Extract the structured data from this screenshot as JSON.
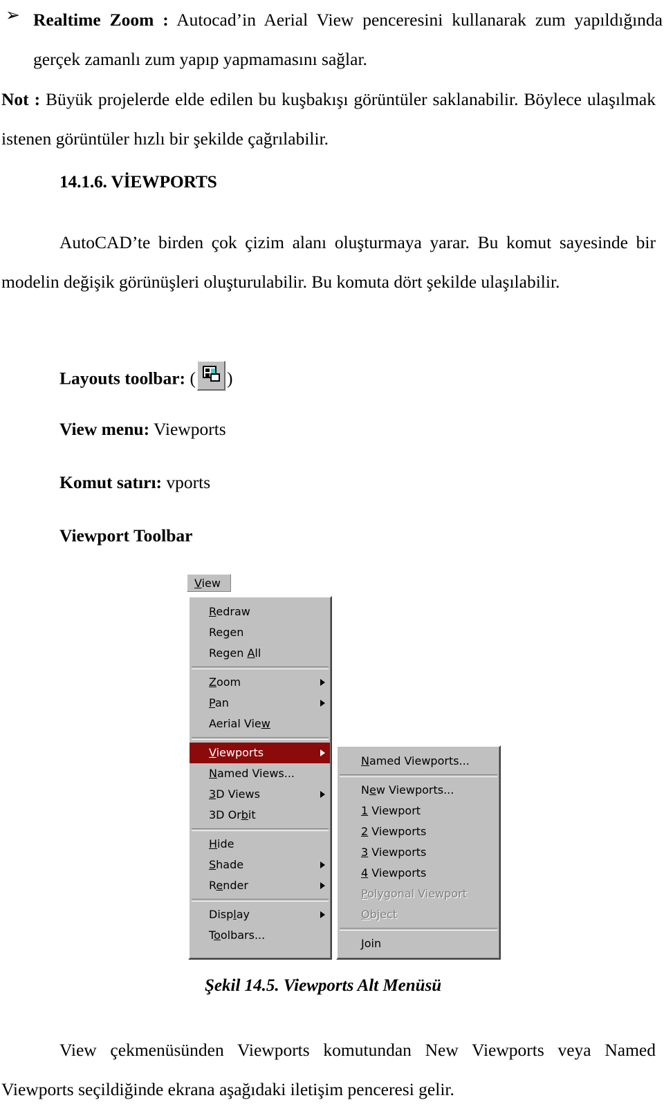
{
  "document": {
    "bullet_glyph": "➢",
    "intro_bullet": {
      "term": "Realtime Zoom :",
      "text": " Autocad’in Aerial View penceresini kullanarak zum yapıldığında gerçek zamanlı zum yapıp yapmamasını sağlar."
    },
    "note": {
      "term": "Not :",
      "text": " Büyük projelerde elde edilen bu kuşbakışı görüntüler saklanabilir. Böylece ulaşılmak istenen görüntüler hızlı bir şekilde çağrılabilir."
    },
    "section_heading": "14.1.6. VİEWPORTS",
    "body_paragraph": "AutoCAD’te birden çok çizim alanı oluşturmaya yarar. Bu komut sayesinde bir modelin değişik görünüşleri oluşturulabilir. Bu komuta dört şekilde ulaşılabilir.",
    "access_methods": {
      "toolbar_label": "Layouts toolbar:",
      "toolbar_paren_open": "(",
      "toolbar_paren_close": ")",
      "toolbar_icon_name": "viewports-toolbar-icon",
      "menu_label": "View menu:",
      "menu_value": "Viewports",
      "command_label": "Komut satırı:",
      "command_value": "vports",
      "toolbar_heading": "Viewport Toolbar"
    },
    "figure_caption": "Şekil 14.5. Viewports Alt Menüsü",
    "closing_paragraph": "View çekmenüsünden Viewports komutundan New Viewports veya Named Viewports seçildiğinde ekrana aşağıdaki iletişim penceresi gelir."
  },
  "screenshot": {
    "menubar": {
      "view_button": "View"
    },
    "view_menu": {
      "items": [
        {
          "label": "Redraw",
          "accel": "R",
          "submenu": false,
          "state": "normal",
          "separator_after": false
        },
        {
          "label": "Regen",
          "accel": "g",
          "submenu": false,
          "state": "normal",
          "separator_after": false
        },
        {
          "label": "Regen All",
          "accel": "A",
          "submenu": false,
          "state": "normal",
          "separator_after": true
        },
        {
          "label": "Zoom",
          "accel": "Z",
          "submenu": true,
          "state": "normal",
          "separator_after": false
        },
        {
          "label": "Pan",
          "accel": "P",
          "submenu": true,
          "state": "normal",
          "separator_after": false
        },
        {
          "label": "Aerial View",
          "accel": "w",
          "submenu": false,
          "state": "normal",
          "separator_after": true
        },
        {
          "label": "Viewports",
          "accel": "V",
          "submenu": true,
          "state": "selected",
          "separator_after": false
        },
        {
          "label": "Named Views...",
          "accel": "N",
          "submenu": false,
          "state": "normal",
          "separator_after": false
        },
        {
          "label": "3D Views",
          "accel": "3",
          "submenu": true,
          "state": "normal",
          "separator_after": false
        },
        {
          "label": "3D Orbit",
          "accel": "b",
          "submenu": false,
          "state": "normal",
          "separator_after": true
        },
        {
          "label": "Hide",
          "accel": "H",
          "submenu": false,
          "state": "normal",
          "separator_after": false
        },
        {
          "label": "Shade",
          "accel": "S",
          "submenu": true,
          "state": "normal",
          "separator_after": false
        },
        {
          "label": "Render",
          "accel": "e",
          "submenu": true,
          "state": "normal",
          "separator_after": true
        },
        {
          "label": "Display",
          "accel": "l",
          "submenu": true,
          "state": "normal",
          "separator_after": false
        },
        {
          "label": "Toolbars...",
          "accel": "o",
          "submenu": false,
          "state": "normal",
          "separator_after": false
        }
      ]
    },
    "viewports_submenu": {
      "items": [
        {
          "label": "Named Viewports...",
          "accel": "N",
          "state": "normal",
          "separator_after": true
        },
        {
          "label": "New Viewports...",
          "accel": "e",
          "state": "normal",
          "separator_after": false
        },
        {
          "label": "1 Viewport",
          "accel": "1",
          "state": "normal",
          "separator_after": false
        },
        {
          "label": "2 Viewports",
          "accel": "2",
          "state": "normal",
          "separator_after": false
        },
        {
          "label": "3 Viewports",
          "accel": "3",
          "state": "normal",
          "separator_after": false
        },
        {
          "label": "4 Viewports",
          "accel": "4",
          "state": "normal",
          "separator_after": false
        },
        {
          "label": "Polygonal Viewport",
          "accel": "P",
          "state": "disabled",
          "separator_after": false
        },
        {
          "label": "Object",
          "accel": "O",
          "state": "disabled",
          "separator_after": true
        },
        {
          "label": "Join",
          "accel": "J",
          "state": "normal",
          "separator_after": false
        }
      ]
    },
    "colors": {
      "menu_face": "#c0c0c0",
      "highlight": "#8b0a0a",
      "highlight_text": "#ffffff",
      "disabled_text": "#808080",
      "icon_accent": "#3fcfcf"
    }
  }
}
